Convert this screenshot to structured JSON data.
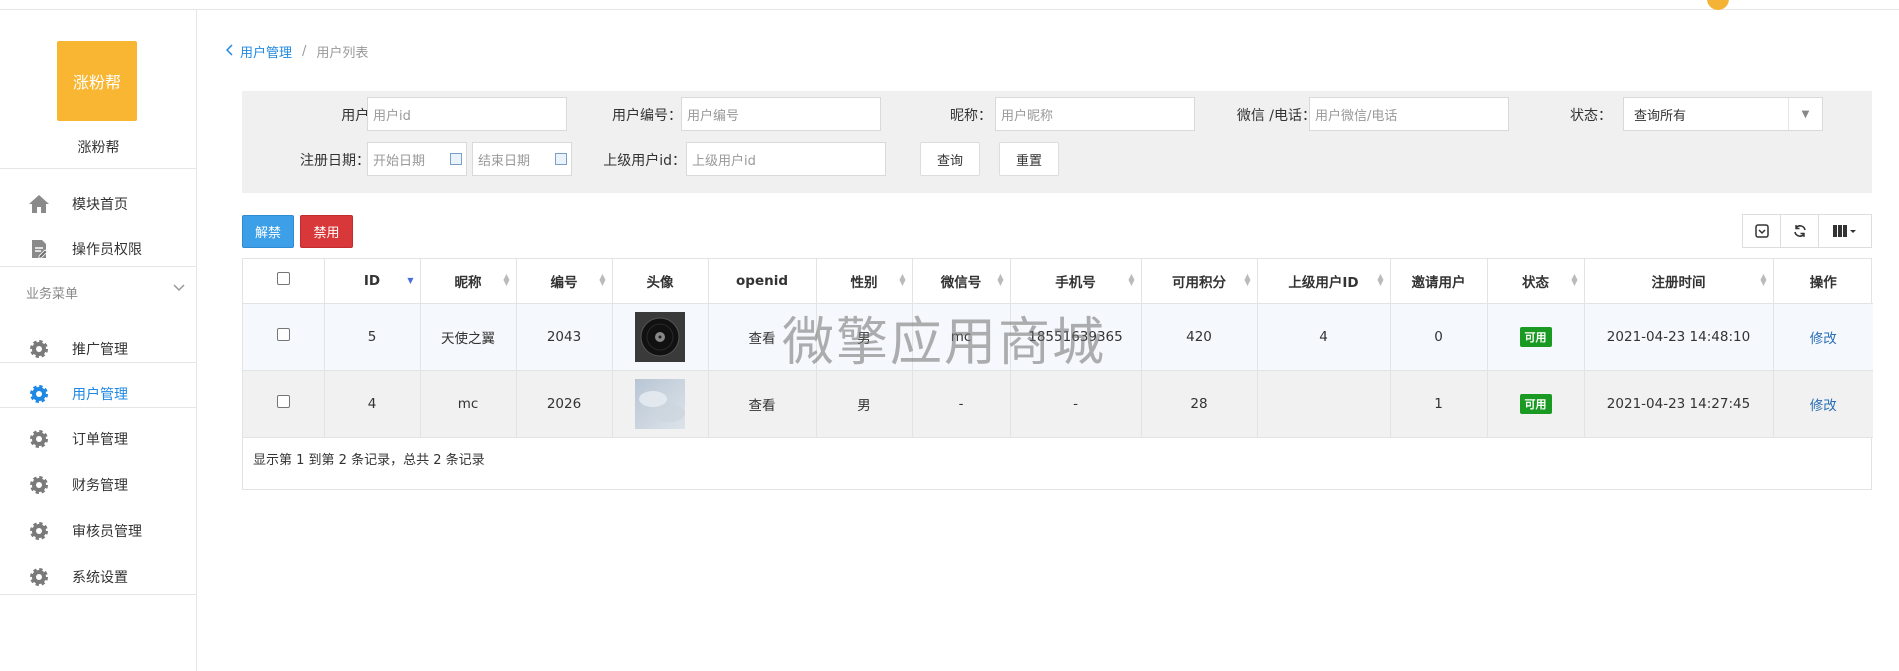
{
  "sidebar": {
    "logo_text": "涨粉帮",
    "app_name": "涨粉帮",
    "top_items": [
      {
        "label": "模块首页",
        "icon": "home-icon"
      },
      {
        "label": "操作员权限",
        "icon": "document-edit-icon"
      }
    ],
    "section_title": "业务菜单",
    "items": [
      {
        "label": "推广管理",
        "icon": "gear-icon"
      },
      {
        "label": "用户管理",
        "icon": "gear-icon",
        "active": true
      },
      {
        "label": "订单管理",
        "icon": "gear-icon"
      },
      {
        "label": "财务管理",
        "icon": "gear-icon"
      },
      {
        "label": "审核员管理",
        "icon": "gear-icon"
      },
      {
        "label": "系统设置",
        "icon": "gear-icon"
      }
    ]
  },
  "breadcrumb": {
    "parent": "用户管理",
    "separator": "/",
    "current": "用户列表"
  },
  "filters": {
    "user_id": {
      "label": "用户id：",
      "placeholder": "用户id"
    },
    "user_no": {
      "label": "用户编号：",
      "placeholder": "用户编号"
    },
    "nickname": {
      "label": "昵称：",
      "placeholder": "用户昵称"
    },
    "wechat_phone": {
      "label": "微信 /电话：",
      "placeholder": "用户微信/电话"
    },
    "status": {
      "label": "状态：",
      "value": "查询所有"
    },
    "reg_date": {
      "label": "注册日期：",
      "start_placeholder": "开始日期",
      "end_placeholder": "结束日期"
    },
    "parent_id": {
      "label": "上级用户id：",
      "placeholder": "上级用户id"
    },
    "query_button": "查询",
    "reset_button": "重置"
  },
  "actions": {
    "unban": "解禁",
    "ban": "禁用"
  },
  "table": {
    "headers": [
      "ID",
      "昵称",
      "编号",
      "头像",
      "openid",
      "性别",
      "微信号",
      "手机号",
      "可用积分",
      "上级用户ID",
      "邀请用户",
      "状态",
      "注册时间",
      "操作"
    ],
    "rows": [
      {
        "id": "5",
        "nickname": "天使之翼",
        "no": "2043",
        "openid": "查看",
        "gender": "男",
        "wechat": "mc",
        "phone": "18551639365",
        "points": "420",
        "parent_id": "4",
        "invited": "0",
        "status": "可用",
        "reg_time": "2021-04-23 14:48:10",
        "action": "修改"
      },
      {
        "id": "4",
        "nickname": "mc",
        "no": "2026",
        "openid": "查看",
        "gender": "男",
        "wechat": "-",
        "phone": "-",
        "points": "28",
        "parent_id": "",
        "invited": "1",
        "status": "可用",
        "reg_time": "2021-04-23 14:27:45",
        "action": "修改"
      }
    ],
    "footer": "显示第 1 到第 2 条记录，总共 2 条记录"
  },
  "watermark": "微擎应用商城",
  "colors": {
    "accent": "#1e88e5",
    "logo": "#f9b632",
    "status_ok": "#1a9a23",
    "danger": "#d9383a"
  }
}
